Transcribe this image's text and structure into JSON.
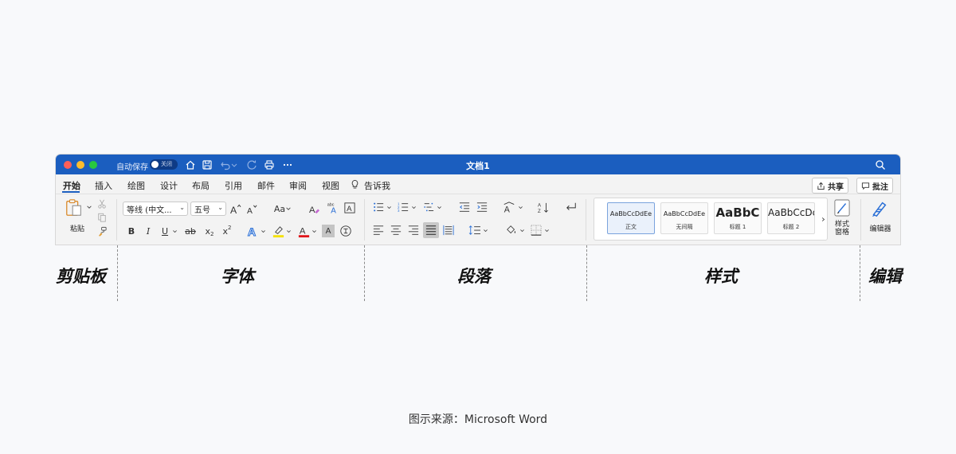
{
  "window": {
    "title": "文档1",
    "autosave_label": "自动保存",
    "autosave_state": "关闭",
    "accent_color": "#1b5ebf"
  },
  "tabs": [
    {
      "label": "开始",
      "active": true
    },
    {
      "label": "插入"
    },
    {
      "label": "绘图"
    },
    {
      "label": "设计"
    },
    {
      "label": "布局"
    },
    {
      "label": "引用"
    },
    {
      "label": "邮件"
    },
    {
      "label": "审阅"
    },
    {
      "label": "视图"
    }
  ],
  "tell_me": "告诉我",
  "share_label": "共享",
  "comments_label": "批注",
  "clipboard": {
    "paste_label": "粘贴"
  },
  "font": {
    "font_name": "等线 (中文...",
    "font_size": "五号",
    "case_label": "Aa",
    "superscript_label": "abc",
    "bold": "B",
    "italic": "I",
    "underline": "U",
    "strike": "ab",
    "subscript": "x",
    "superscript": "x",
    "text_effect": "A",
    "font_color": "A",
    "char_shading": "A",
    "highlight_color": "#f4e100",
    "font_color_value": "#e0161b"
  },
  "styles": {
    "items": [
      {
        "sample": "AaBbCcDdEe",
        "name": "正文"
      },
      {
        "sample": "AaBbCcDdEe",
        "name": "无间隔"
      },
      {
        "sample": "AaBbC",
        "name": "标题 1"
      },
      {
        "sample": "AaBbCcDc",
        "name": "标题 2"
      }
    ],
    "pane_label": "样式\n窗格"
  },
  "editor_label": "编辑器",
  "groups": {
    "clipboard": "剪贴板",
    "font": "字体",
    "paragraph": "段落",
    "styles": "样式",
    "editing": "编辑"
  },
  "source": "图示来源：Microsoft Word"
}
